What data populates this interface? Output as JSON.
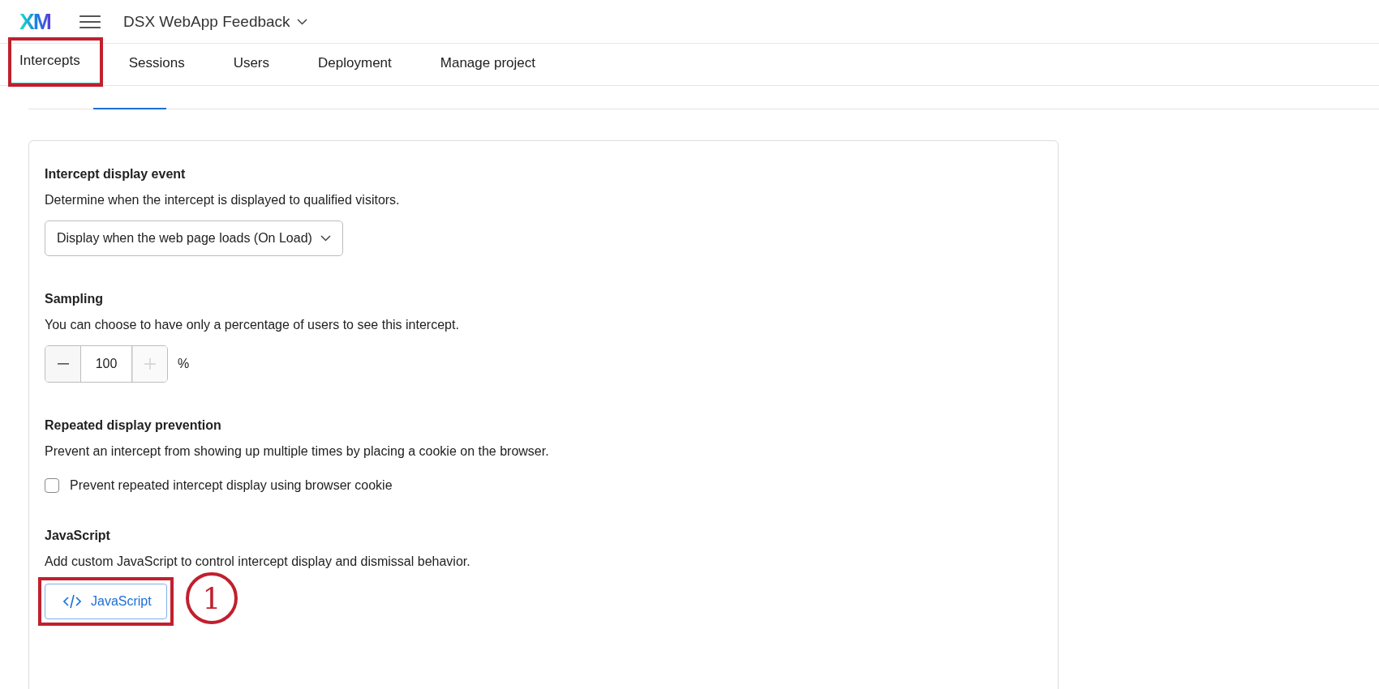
{
  "header": {
    "logo": "XM",
    "project": "DSX WebApp Feedback"
  },
  "nav_tabs": [
    {
      "label": "Intercepts",
      "selected": true,
      "highlighted": true
    },
    {
      "label": "Sessions",
      "selected": false,
      "highlighted": false
    },
    {
      "label": "Users",
      "selected": false,
      "highlighted": false
    },
    {
      "label": "Deployment",
      "selected": false,
      "highlighted": false
    },
    {
      "label": "Manage project",
      "selected": false,
      "highlighted": false
    }
  ],
  "sections": [
    {
      "kind": "select",
      "title": "Intercept display event",
      "description": "Determine when the intercept is displayed to qualified visitors.",
      "value": "Display when the web page loads (On Load)"
    },
    {
      "kind": "stepper",
      "title": "Sampling",
      "description": "You can choose to have only a percentage of users to see this intercept.",
      "value": "100",
      "unit": "%",
      "plus_disabled": true
    },
    {
      "kind": "checkbox",
      "title": "Repeated display prevention",
      "description": "Prevent an intercept from showing up multiple times by placing a cookie on the browser.",
      "label": "Prevent repeated intercept display using browser cookie",
      "checked": false
    },
    {
      "kind": "button",
      "title": "JavaScript",
      "description": "Add custom JavaScript to control intercept display and dismissal behavior.",
      "label": "JavaScript",
      "highlighted": true,
      "callout": "1"
    }
  ]
}
